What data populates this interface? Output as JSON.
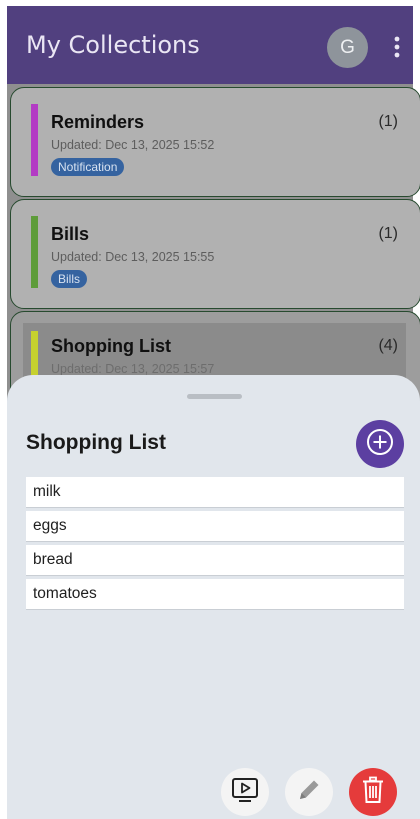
{
  "appbar": {
    "title": "My Collections",
    "avatar_initial": "G",
    "color": "#51407f"
  },
  "collections": [
    {
      "title": "Reminders",
      "count": "(1)",
      "updated": "Updated: Dec 13, 2025 15:52",
      "tag": "Notification",
      "accent": "#b33bc4"
    },
    {
      "title": "Bills",
      "count": "(1)",
      "updated": "Updated: Dec 13, 2025 15:55",
      "tag": "Bills",
      "accent": "#5e9c3a"
    },
    {
      "title": "Shopping List",
      "count": "(4)",
      "updated": "Updated: Dec 13, 2025 15:57",
      "accent": "#c6d12f"
    }
  ],
  "sheet": {
    "title": "Shopping List",
    "items": [
      "milk",
      "eggs",
      "bread",
      "tomatoes"
    ]
  },
  "actions": {
    "add_icon": "plus-circle-icon",
    "play_icon": "play-icon",
    "edit_icon": "pencil-icon",
    "delete_icon": "trash-icon",
    "delete_color": "#e53b3b"
  }
}
